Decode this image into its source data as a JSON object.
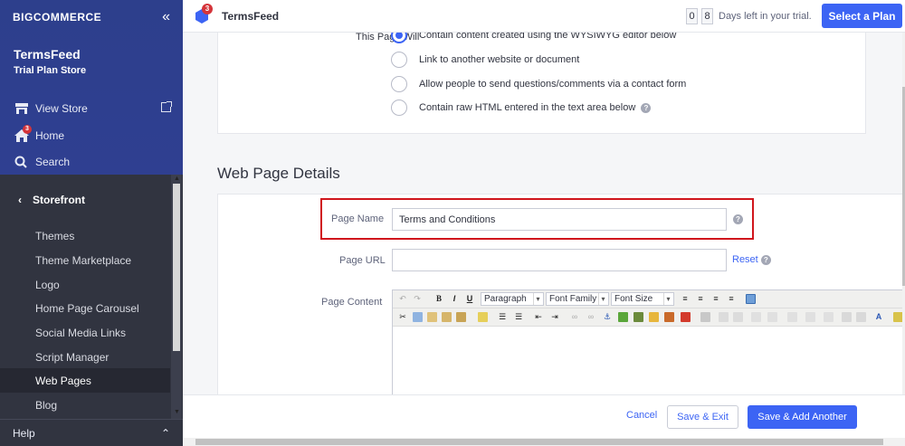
{
  "sidebar": {
    "logo_part1": "BIG",
    "logo_part2": "COMMERCE",
    "store_name": "TermsFeed",
    "store_plan": "Trial Plan Store",
    "view_store": "View Store",
    "home": "Home",
    "home_badge": "3",
    "search": "Search",
    "storefront": "Storefront",
    "items": [
      "Themes",
      "Theme Marketplace",
      "Logo",
      "Home Page Carousel",
      "Social Media Links",
      "Script Manager",
      "Web Pages",
      "Blog"
    ],
    "active_item": "Web Pages",
    "help": "Help"
  },
  "header": {
    "badge": "3",
    "title": "TermsFeed",
    "trial_digits": [
      "0",
      "8"
    ],
    "trial_text": "Days left in your trial.",
    "select_plan": "Select a Plan"
  },
  "page_will": {
    "label": "This Page Will",
    "options": [
      {
        "text": "Contain content created using the WYSIWYG editor below",
        "checked": true
      },
      {
        "text": "Link to another website or document",
        "checked": false
      },
      {
        "text": "Allow people to send questions/comments via a contact form",
        "checked": false
      },
      {
        "text": "Contain raw HTML entered in the text area below",
        "checked": false
      }
    ]
  },
  "details": {
    "title": "Web Page Details",
    "page_name_label": "Page Name",
    "page_name_value": "Terms and Conditions",
    "page_url_label": "Page URL",
    "page_url_value": "",
    "reset": "Reset",
    "page_content_label": "Page Content"
  },
  "editor": {
    "format": "Paragraph",
    "font_family": "Font Family",
    "font_size": "Font Size",
    "bold": "B",
    "italic": "I",
    "underline": "U"
  },
  "footer": {
    "cancel": "Cancel",
    "save_exit": "Save & Exit",
    "save_add": "Save & Add Another"
  },
  "colors": {
    "brand_blue": "#3c64f4",
    "sidebar_top": "#2d3f8c",
    "sidebar_dark": "#313440",
    "highlight_red": "#d0161d"
  }
}
